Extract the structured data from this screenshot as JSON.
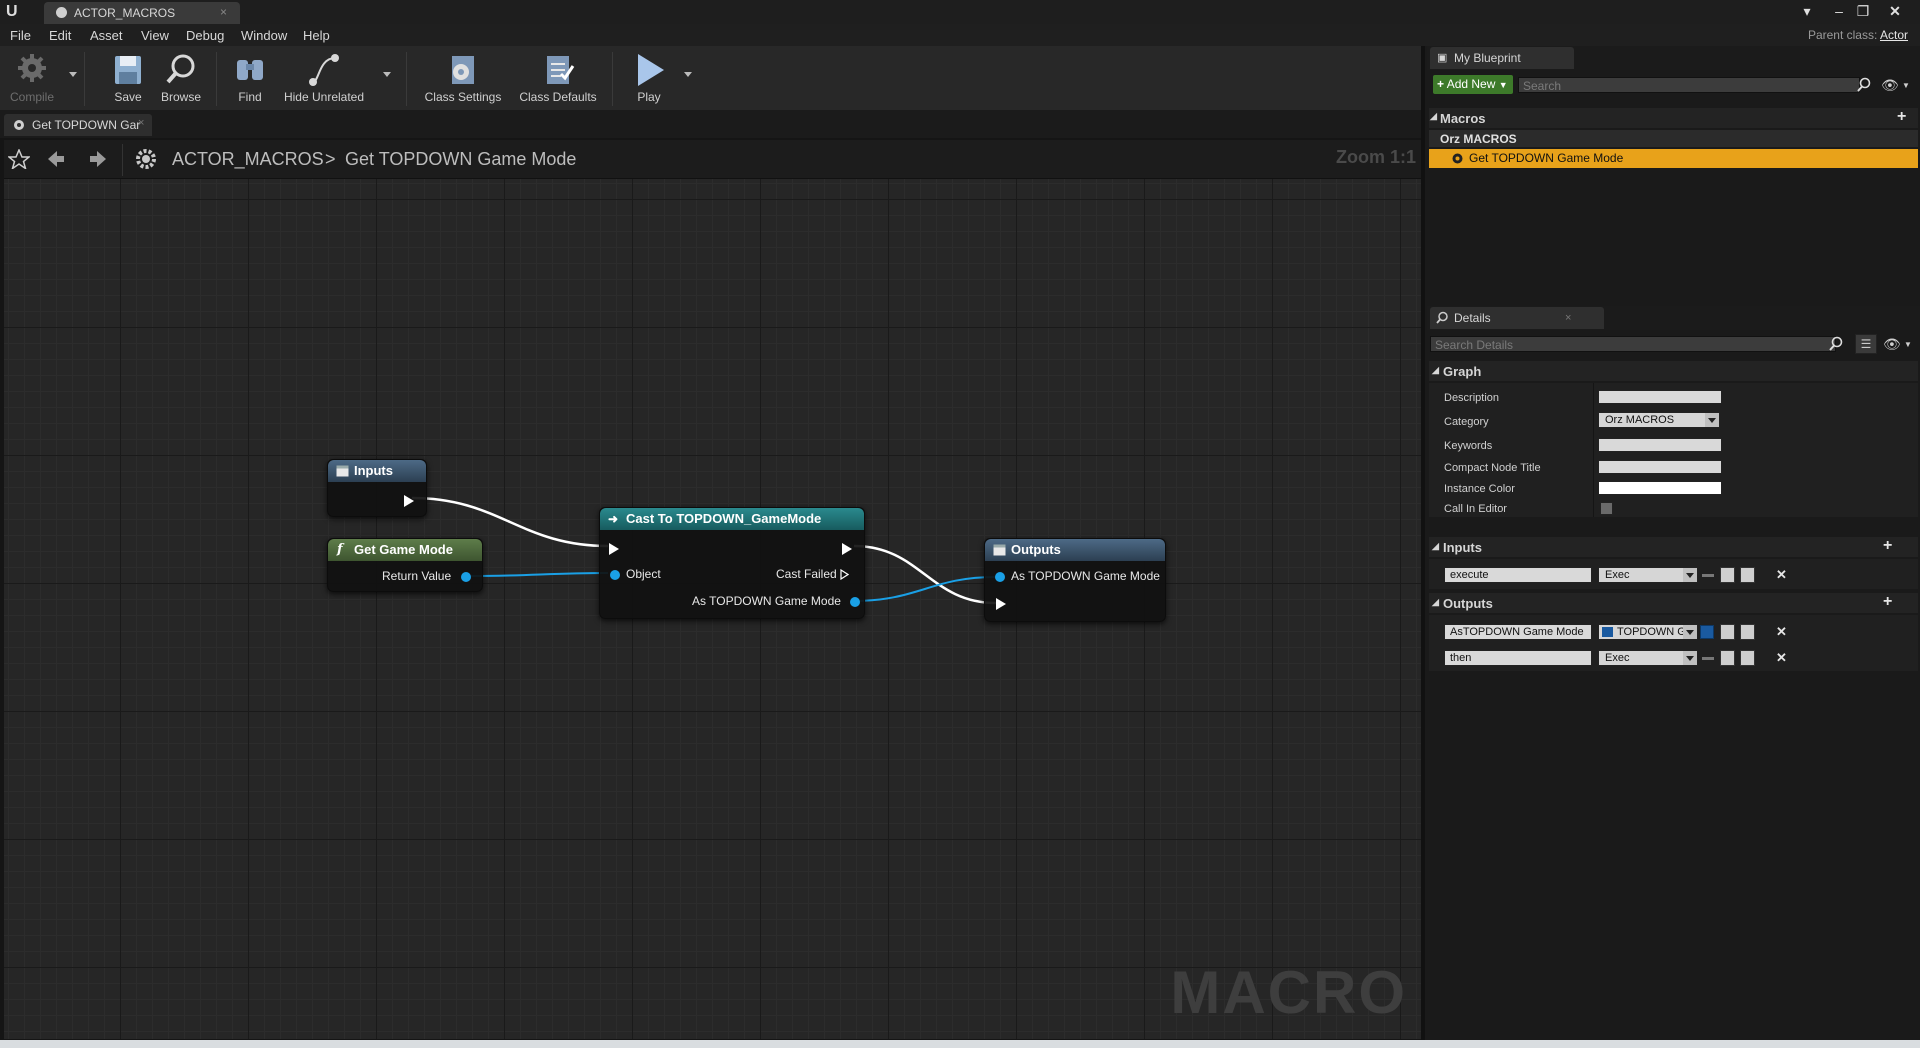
{
  "window": {
    "tab_title": "ACTOR_MACROS",
    "parent_class_label": "Parent class:",
    "parent_class_value": "Actor"
  },
  "menu": [
    "File",
    "Edit",
    "Asset",
    "View",
    "Debug",
    "Window",
    "Help"
  ],
  "toolbar": {
    "compile": "Compile",
    "save": "Save",
    "browse": "Browse",
    "find": "Find",
    "hide_unrelated": "Hide Unrelated",
    "class_settings": "Class Settings",
    "class_defaults": "Class Defaults",
    "play": "Play"
  },
  "graph_tab": "Get TOPDOWN Gar",
  "breadcrumb": {
    "root": "ACTOR_MACROS",
    "separator": ">",
    "current": "Get TOPDOWN Game Mode",
    "zoom": "Zoom 1:1"
  },
  "graph": {
    "watermark": "MACRO",
    "nodes": {
      "inputs": {
        "title": "Inputs"
      },
      "get_game_mode": {
        "title": "Get Game Mode",
        "icon": "f",
        "pin_return": "Return Value"
      },
      "cast": {
        "title": "Cast To TOPDOWN_GameMode",
        "pin_object": "Object",
        "pin_cast_failed": "Cast Failed",
        "pin_as": "As TOPDOWN Game Mode"
      },
      "outputs": {
        "title": "Outputs",
        "pin_as": "As TOPDOWN Game Mode"
      }
    },
    "colors": {
      "data_pin": "#1aa0e6",
      "exec_pin": "#ffffff",
      "cast_header": "#1d6f72",
      "func_header": "#4b6b3e",
      "tunnel_header": "#3e5a72"
    }
  },
  "my_blueprint": {
    "tab": "My Blueprint",
    "add_new": "Add New",
    "search_placeholder": "Search",
    "macros_header": "Macros",
    "category": "Orz MACROS",
    "selected_item": "Get TOPDOWN Game Mode"
  },
  "details": {
    "tab": "Details",
    "search_placeholder": "Search Details",
    "graph_header": "Graph",
    "props": {
      "description": "Description",
      "category": "Category",
      "category_value": "Orz MACROS",
      "keywords": "Keywords",
      "compact_title": "Compact Node Title",
      "instance_color": "Instance Color",
      "call_in_editor": "Call In Editor"
    },
    "inputs_header": "Inputs",
    "inputs": [
      {
        "name": "execute",
        "type": "Exec"
      }
    ],
    "outputs_header": "Outputs",
    "outputs": [
      {
        "name": "AsTOPDOWN Game Mode",
        "type": "TOPDOWN Ga"
      },
      {
        "name": "then",
        "type": "Exec"
      }
    ]
  }
}
